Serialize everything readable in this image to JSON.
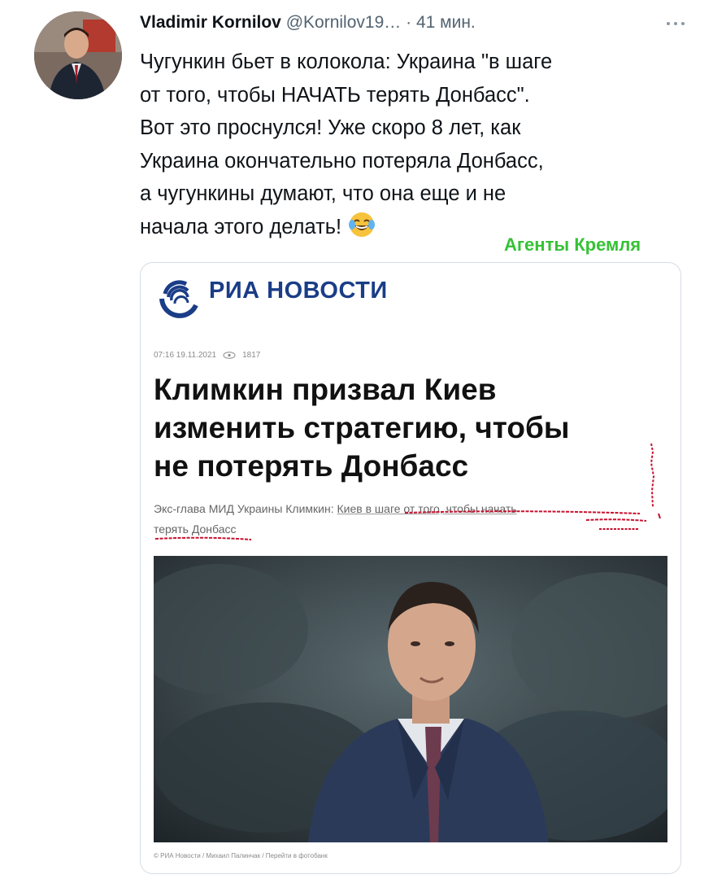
{
  "tweet": {
    "display_name": "Vladimir Kornilov",
    "handle": "@Kornilov19…",
    "separator": "·",
    "time": "41 мин.",
    "text_lines": [
      "Чугункин бьет в колокола: Украина \"в шаге",
      "от того, чтобы НАЧАТЬ терять Донбасс\".",
      "Вот это проснулся! Уже скоро 8 лет, как",
      "Украина окончательно потеряла Донбасс,",
      "а чугункины думают, что она еще и не",
      "начала этого делать!"
    ],
    "emoji_icon": "face-with-tears-of-joy-icon",
    "more_icon": "more-dots-icon"
  },
  "watermark": "Агенты Кремля",
  "card": {
    "outlet": "РИА НОВОСТИ",
    "logo_icon": "ria-logo-icon",
    "timestamp": "07:16 19.11.2021",
    "views": "1817",
    "view_icon": "eye-icon",
    "headline_lines": [
      "Климкин призвал Киев",
      "изменить стратегию, чтобы",
      "не потерять Донбасс"
    ],
    "lead_prefix": "Экс-глава МИД Украины Климкин: ",
    "lead_link": "Киев в шаге от того, чтобы начать",
    "lead_line2": "терять Донбасс",
    "caption": "© РИА Новости / Михаил Палинчак / Перейти в фотобанк"
  },
  "colors": {
    "brand_blue": "#1a3d87",
    "watermark_green": "#35c235",
    "annotation_red": "#c8102e"
  }
}
